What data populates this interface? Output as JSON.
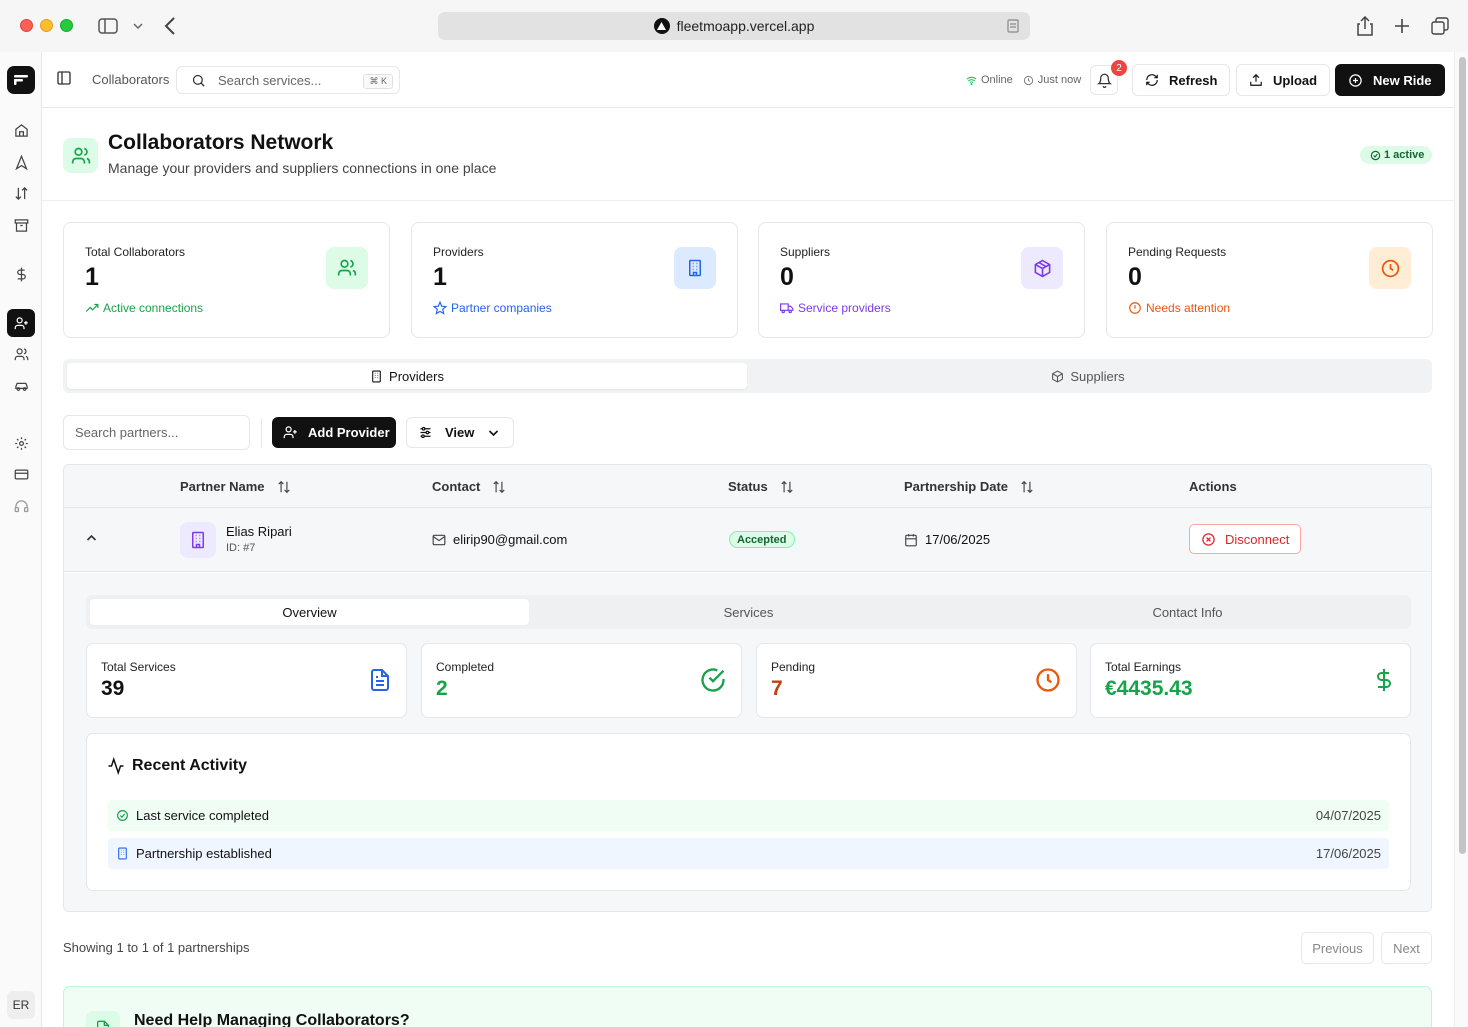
{
  "browser": {
    "url": "fleetmoapp.vercel.app"
  },
  "sidebar": {
    "avatar_initials": "ER",
    "items": [
      {
        "icon": "home-icon"
      },
      {
        "icon": "navigation-icon"
      },
      {
        "icon": "transfer-icon"
      },
      {
        "icon": "archive-icon"
      },
      {
        "icon": "dollar-icon"
      },
      {
        "icon": "user-plus-icon",
        "active": true
      },
      {
        "icon": "users-icon"
      },
      {
        "icon": "car-icon"
      },
      {
        "icon": "settings-icon"
      },
      {
        "icon": "credit-card-icon"
      },
      {
        "icon": "headset-icon"
      }
    ]
  },
  "topbar": {
    "breadcrumb": "Collaborators",
    "search_placeholder": "Search services...",
    "search_shortcut": "⌘ K",
    "status_online": "Online",
    "status_updated": "Just now",
    "notification_count": "2",
    "refresh_label": "Refresh",
    "upload_label": "Upload",
    "new_ride_label": "New Ride"
  },
  "header": {
    "title": "Collaborators Network",
    "subtitle": "Manage your providers and suppliers connections in one place",
    "active_badge": "1 active"
  },
  "stats": [
    {
      "label": "Total Collaborators",
      "value": "1",
      "footer": "Active connections",
      "color": "#16a34a",
      "bg": "#dcfce7"
    },
    {
      "label": "Providers",
      "value": "1",
      "footer": "Partner companies",
      "color": "#2563eb",
      "bg": "#dbeafe"
    },
    {
      "label": "Suppliers",
      "value": "0",
      "footer": "Service providers",
      "color": "#7c3aed",
      "bg": "#ede9fe"
    },
    {
      "label": "Pending Requests",
      "value": "0",
      "footer": "Needs attention",
      "color": "#ea580c",
      "bg": "#ffedd5"
    }
  ],
  "tabs": {
    "providers": "Providers",
    "suppliers": "Suppliers"
  },
  "toolbar": {
    "search_placeholder": "Search partners...",
    "add_label": "Add Provider",
    "view_label": "View"
  },
  "table": {
    "headers": {
      "partner": "Partner Name",
      "contact": "Contact",
      "status": "Status",
      "date": "Partnership Date",
      "actions": "Actions"
    },
    "row": {
      "name": "Elias Ripari",
      "id": "ID: #7",
      "email": "elirip90@gmail.com",
      "status": "Accepted",
      "date": "17/06/2025",
      "action": "Disconnect"
    }
  },
  "detail": {
    "tabs": {
      "overview": "Overview",
      "services": "Services",
      "contact": "Contact Info"
    },
    "metrics": [
      {
        "label": "Total Services",
        "value": "39",
        "color": "#111111",
        "icon_color": "#2563eb"
      },
      {
        "label": "Completed",
        "value": "2",
        "color": "#16a34a",
        "icon_color": "#16a34a"
      },
      {
        "label": "Pending",
        "value": "7",
        "color": "#c2410c",
        "icon_color": "#ea580c"
      },
      {
        "label": "Total Earnings",
        "value": "€4435.43",
        "color": "#16a34a",
        "icon_color": "#16a34a"
      }
    ],
    "activity": {
      "title": "Recent Activity",
      "items": [
        {
          "text": "Last service completed",
          "date": "04/07/2025",
          "bg": "#f0fdf4"
        },
        {
          "text": "Partnership established",
          "date": "17/06/2025",
          "bg": "#eff6ff"
        }
      ]
    }
  },
  "pagination": {
    "summary": "Showing 1 to 1 of 1 partnerships",
    "previous": "Previous",
    "next": "Next"
  },
  "help": {
    "title": "Need Help Managing Collaborators?"
  }
}
